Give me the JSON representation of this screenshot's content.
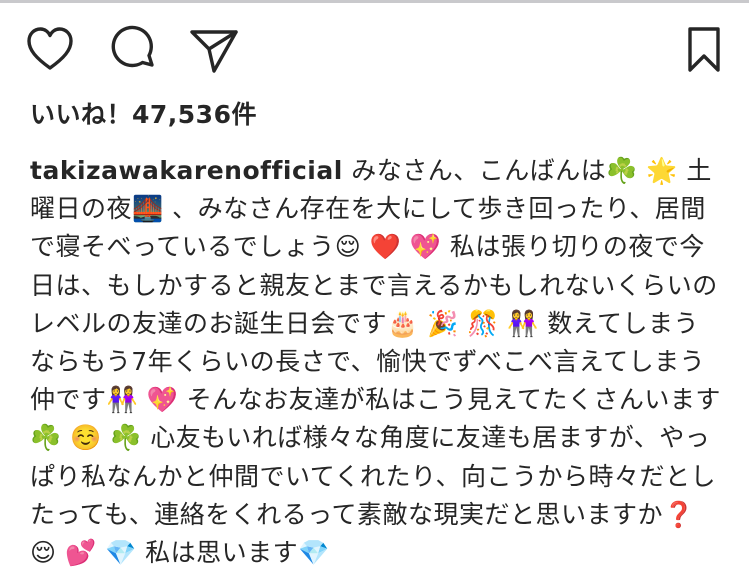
{
  "post": {
    "likes_text": "いいね！47,536件",
    "username": "takizawakarenofficial",
    "caption": " みなさん、こんばんは☘️ 🌟 土曜日の夜🌉 、みなさん存在を大にして歩き回ったり、居間で寝そべっているでしょう😌 ❤️ 💖 私は張り切りの夜で今日は、もしかすると親友とまで言えるかもしれないくらいのレベルの友達のお誕生日会です🎂 🎉 🎊 👭 数えてしまうならもう7年くらいの長さで、愉快でずべこべ言えてしまう仲です👭 💖 そんなお友達が私はこう見えてたくさんいます☘️ ☺️ ☘️ 心友もいれば様々な角度に友達も居ますが、やっぱり私なんかと仲間でいてくれたり、向こうから時々だとしたっても、連絡をくれるって素敵な現実だと思いますか❓ 😌 💕 💎 私は思います💎"
  },
  "icons": {
    "like": "heart-icon",
    "comment": "comment-bubble-icon",
    "share": "paper-plane-icon",
    "save": "bookmark-icon"
  },
  "colors": {
    "text": "#262626",
    "background": "#ffffff"
  }
}
